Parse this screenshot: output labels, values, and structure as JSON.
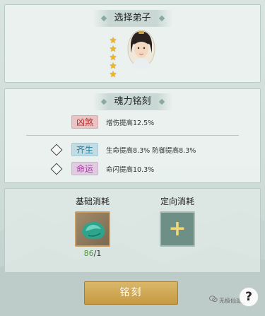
{
  "select_disciple": {
    "title": "选择弟子",
    "star_count": 5
  },
  "soul_engrave": {
    "title": "魂力铭刻",
    "rows": [
      {
        "tag": "凶煞",
        "text": "增伤提高12.5%",
        "has_checkbox": false
      },
      {
        "tag": "齐生",
        "text": "生命提高8.3% 防御提高8.3%",
        "has_checkbox": true
      },
      {
        "tag": "命运",
        "text": "命闪提高10.3%",
        "has_checkbox": true
      }
    ]
  },
  "cost": {
    "basic_label": "基础消耗",
    "targeted_label": "定向消耗",
    "basic_have": "86",
    "basic_need": "/1"
  },
  "engrave_button": "铭刻",
  "watermark": "无极仙途",
  "help_label": "?",
  "colors": {
    "tag_red": "#b82e2e",
    "tag_teal": "#2c7e98",
    "tag_purple": "#a33e9f",
    "button_gold": "#c69a42",
    "count_green": "#4e9a2f"
  }
}
